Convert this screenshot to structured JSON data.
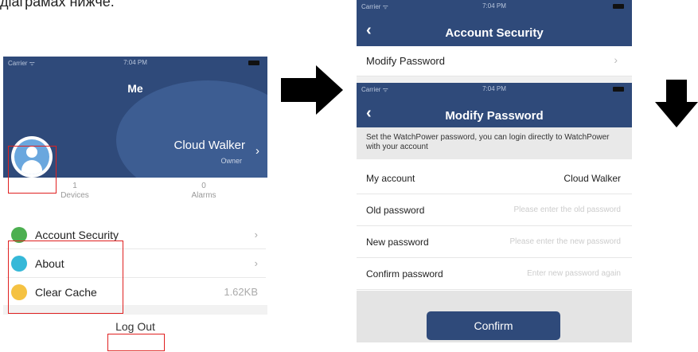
{
  "caption": "діаграмах нижче.",
  "arrows": [
    "arrow-right",
    "arrow-down"
  ],
  "colors": {
    "navy": "#2f4a7a",
    "highlight": "#e02020"
  },
  "screen1": {
    "status": {
      "carrier": "Carrier ᯤ",
      "time": "7:04 PM"
    },
    "title": "Me",
    "user": {
      "name": "Cloud Walker",
      "role": "Owner",
      "avatar_icon": "user-avatar-icon",
      "chevron": "›"
    },
    "stats": [
      {
        "value": "1",
        "label": "Devices"
      },
      {
        "value": "0",
        "label": "Alarms"
      }
    ],
    "menu": [
      {
        "label": "Account Security",
        "icon": "shield-icon",
        "right": "›",
        "color": "#4caf50"
      },
      {
        "label": "About",
        "icon": "info-icon",
        "right": "›",
        "color": "#35b8d8"
      },
      {
        "label": "Clear Cache",
        "icon": "broom-icon",
        "right": "1.62KB",
        "color": "#f5c242"
      }
    ],
    "logout": "Log Out"
  },
  "screen2": {
    "security": {
      "status": {
        "carrier": "Carrier ᯤ",
        "time": "7:04 PM"
      },
      "back": "‹",
      "title": "Account Security",
      "row": {
        "label": "Modify Password",
        "chevron": "›"
      }
    },
    "modify": {
      "status": {
        "carrier": "Carrier ᯤ",
        "time": "7:04 PM"
      },
      "back": "‹",
      "title": "Modify Password",
      "hint": "Set the WatchPower password, you can login directly to WatchPower with your account",
      "account": {
        "label": "My account",
        "value": "Cloud Walker"
      },
      "old_password": {
        "label": "Old password",
        "placeholder": "Please enter the old password"
      },
      "new_password": {
        "label": "New password",
        "placeholder": "Please enter the new password"
      },
      "confirm_password": {
        "label": "Confirm password",
        "placeholder": "Enter new password again"
      },
      "confirm_button": "Confirm"
    }
  }
}
